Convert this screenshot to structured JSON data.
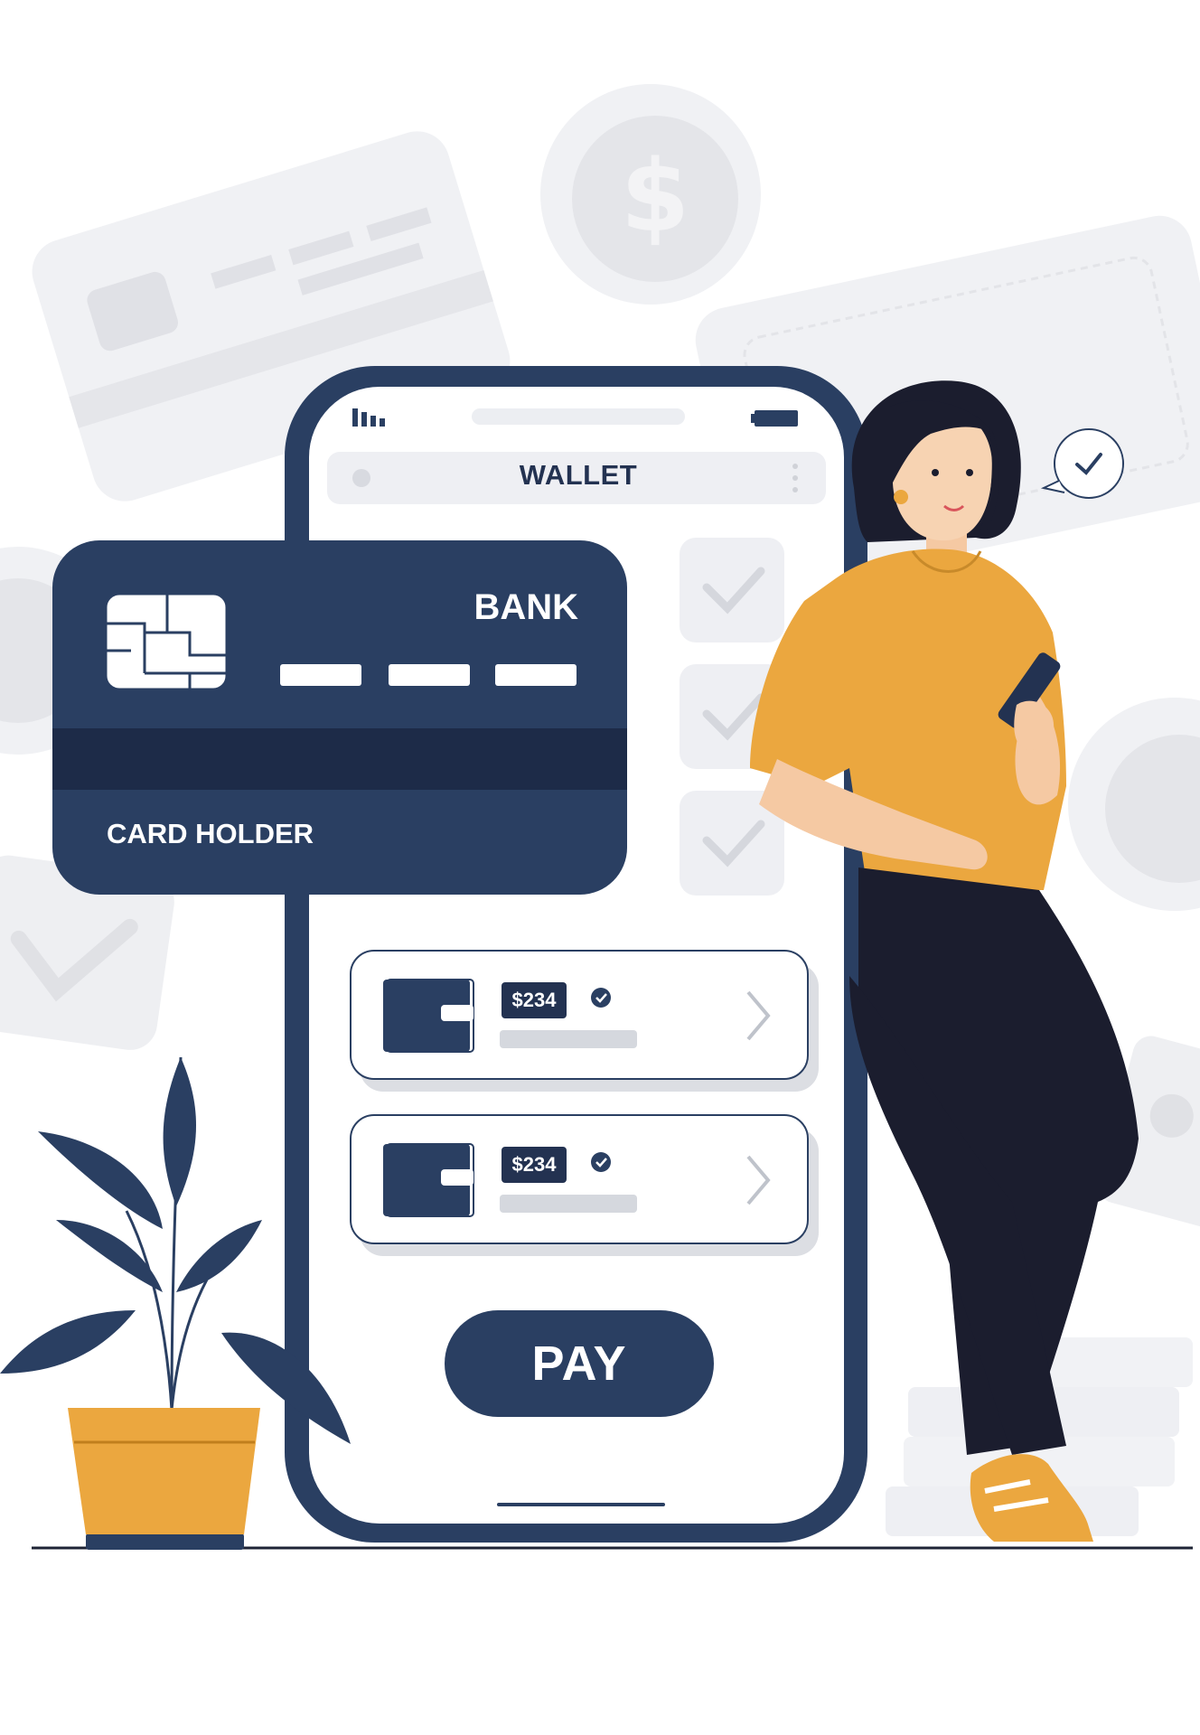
{
  "phone": {
    "title": "WALLET",
    "items": [
      {
        "amount": "$234"
      },
      {
        "amount": "$234"
      }
    ],
    "pay_label": "PAY"
  },
  "card": {
    "bank": "BANK",
    "holder": "CARD HOLDER"
  },
  "colors": {
    "navy": "#2a3f62",
    "dark_navy": "#1d2b48",
    "mustard": "#eba73f",
    "background_gray": "#eeeff3"
  },
  "icons": [
    "coin-icon",
    "signal-icon",
    "battery-icon",
    "check-icon",
    "wallet-icon",
    "chevron-right-icon",
    "chat-bubble-check-icon"
  ]
}
